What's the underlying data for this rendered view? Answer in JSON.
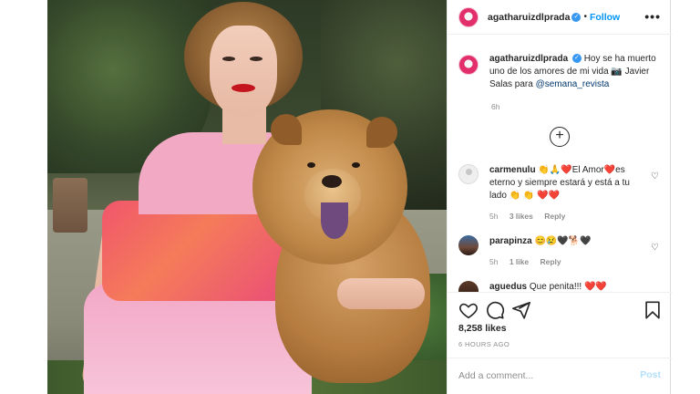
{
  "post": {
    "author": "agatharuizdlprada",
    "follow_label": "Follow",
    "dot": "•",
    "more_label": "•••",
    "caption_text": "Hoy se ha muerto uno de los amores de mi vida 📷 Javier Salas para ",
    "caption_mention": "@semana_revista",
    "caption_time": "6h",
    "load_more_label": "+",
    "likes": "8,258 likes",
    "posted_ago": "6 HOURS AGO"
  },
  "comments": [
    {
      "author": "carmenulu",
      "text": "👏🙏❤️El Amor❤️es eterno y siempre estará y está a tu lado 👏 👏 ❤️❤️",
      "time": "5h",
      "likes": "3 likes",
      "reply": "Reply"
    },
    {
      "author": "parapinza",
      "text": "😊😢🖤🐕🖤",
      "time": "5h",
      "likes": "1 like",
      "reply": "Reply"
    },
    {
      "author": "aguedus",
      "text": "Que penita!!! ❤️❤️"
    }
  ],
  "add_comment": {
    "placeholder": "Add a comment...",
    "post_label": "Post"
  },
  "icons": {
    "heart": "heart-icon",
    "comment": "comment-icon",
    "share": "share-icon",
    "save": "bookmark-icon",
    "verified": "verified-badge-icon"
  },
  "colors": {
    "accent": "#0095f6",
    "muted": "#8e8e8e",
    "text": "#262626",
    "post_disabled": "#b2dffc"
  }
}
